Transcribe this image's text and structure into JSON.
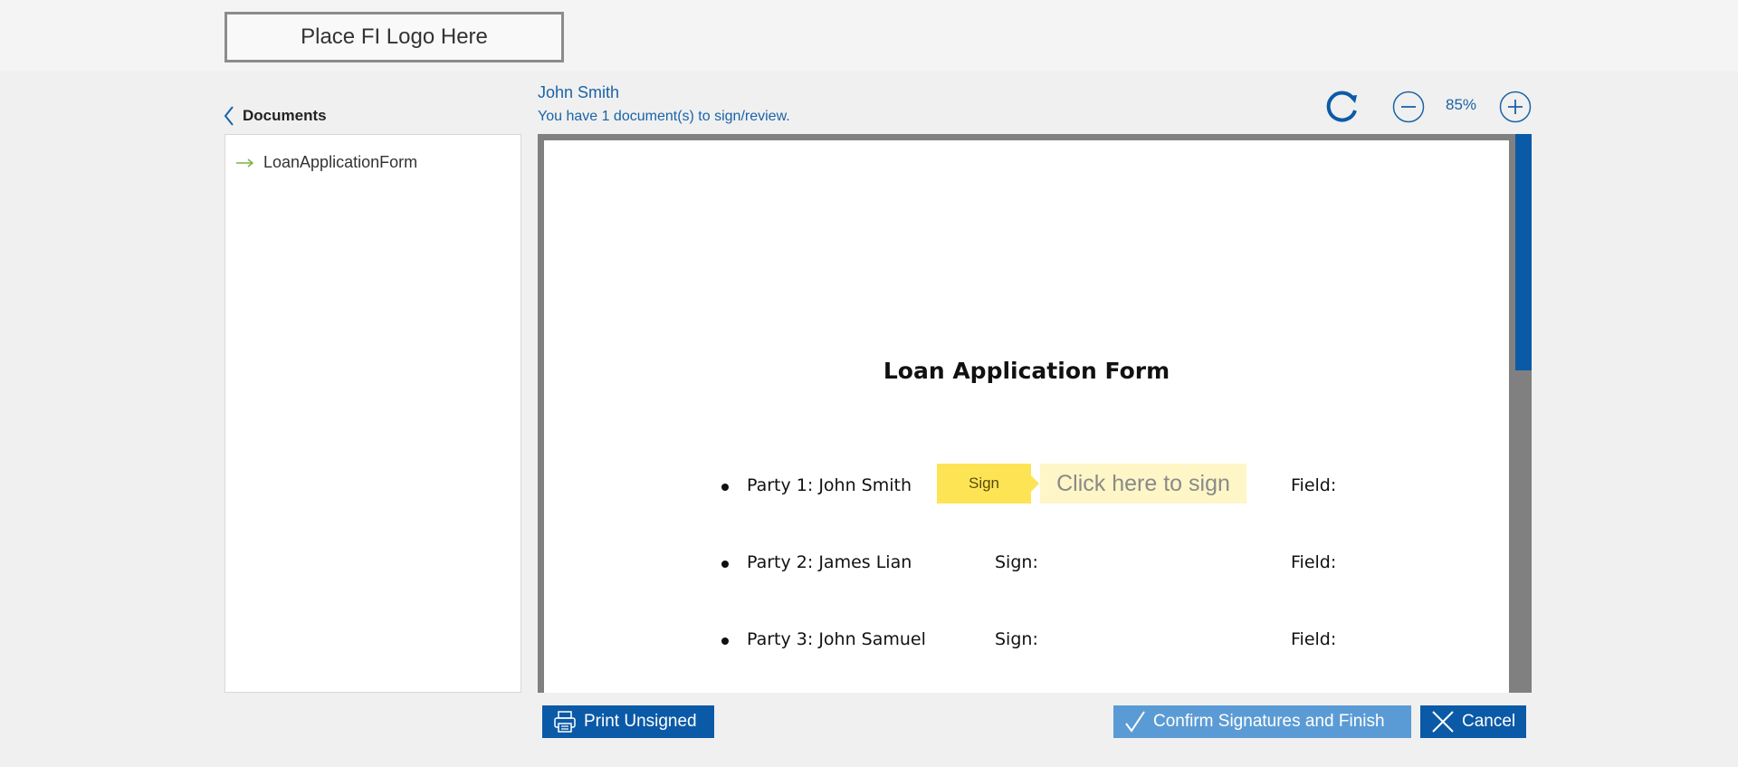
{
  "header": {
    "logo_text": "Place FI Logo Here"
  },
  "sidebar": {
    "title": "Documents",
    "items": [
      {
        "label": "LoanApplicationForm"
      }
    ]
  },
  "main": {
    "user_name": "John Smith",
    "status": "You have 1 document(s) to sign/review.",
    "zoom_level": "85%"
  },
  "document": {
    "title": "Loan Application Form",
    "parties": [
      {
        "name": "Party 1: John Smith",
        "sign_label": "Sign:",
        "sign_tag": "Sign",
        "sign_target": "Click here to sign",
        "field_label": "Field:"
      },
      {
        "name": "Party 2: James Lian",
        "sign_label": "Sign:",
        "field_label": "Field:"
      },
      {
        "name": "Party 3: John Samuel",
        "sign_label": "Sign:",
        "field_label": "Field:"
      }
    ]
  },
  "footer": {
    "print_label": "Print Unsigned",
    "confirm_label": "Confirm Signatures and Finish",
    "cancel_label": "Cancel"
  },
  "colors": {
    "accent": "#0b5aa8",
    "accent_light": "#5b9bd5",
    "sign_tag": "#fde454",
    "sign_target": "#fff6c7",
    "link_text": "#1a63a8",
    "doc_arrow": "#7cb342"
  },
  "icons": {
    "back": "chevron-left-icon",
    "doc_item": "arrow-right-icon",
    "refresh": "refresh-icon",
    "zoom_out": "zoom-out-icon",
    "zoom_in": "zoom-in-icon",
    "print": "printer-icon",
    "confirm": "checkmark-icon",
    "cancel": "close-icon"
  }
}
